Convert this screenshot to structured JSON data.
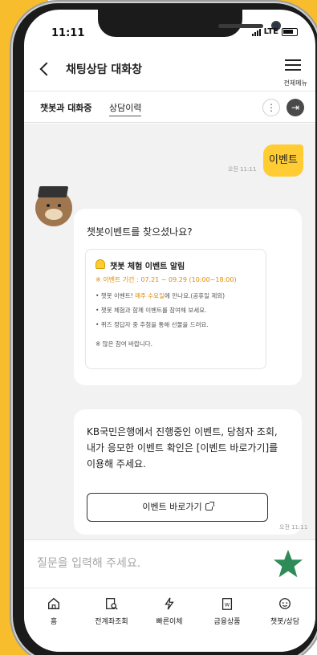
{
  "status_bar": {
    "time": "11:11",
    "network": "LTE"
  },
  "header": {
    "title": "채팅상담 대화창",
    "menu_label": "전체메뉴"
  },
  "tabs": {
    "active": "챗봇과 대화중",
    "history": "상담이력"
  },
  "chat": {
    "user_message": {
      "text": "이벤트",
      "time": "오전 11:11"
    },
    "bot_question": "챗봇이벤트를 찾으셨나요?",
    "notice": {
      "title": "챗봇 체험 이벤트 알림",
      "period": "※ 이벤트 기간 : 07.21 ~ 09.29 (10:00~18:00)",
      "line1_prefix": "• 챗봇 이벤트! ",
      "line1_highlight": "매주 수요일",
      "line1_suffix": "에 만나요.(공휴일 제외)",
      "line2": "• 챗봇 체험과 함께 이벤트를 참여해 보세요.",
      "line3": "• 퀴즈 정답자 중 추첨을 통해 선물을 드려요.",
      "line4": "※ 많은 참여 바랍니다."
    },
    "bot_info": "KB국민은행에서 진행중인 이벤트, 당첨자 조회, 내가 응모한 이벤트 확인은 [이벤트 바로가기]를 이용해 주세요.",
    "link_button": "이벤트 바로가기",
    "bot_time": "오전 11:11"
  },
  "composer": {
    "placeholder": "질문을 입력해 주세요."
  },
  "tabbar": [
    {
      "label": "홈",
      "icon": "home-icon"
    },
    {
      "label": "전계좌조회",
      "icon": "account-search-icon"
    },
    {
      "label": "빠른이체",
      "icon": "quick-transfer-icon"
    },
    {
      "label": "금융상품",
      "icon": "financial-product-icon"
    },
    {
      "label": "챗봇/상담",
      "icon": "chatbot-icon"
    }
  ],
  "colors": {
    "accent": "#ffcc33",
    "send": "#2e8b57",
    "highlight": "#e08b00",
    "background_yellow": "#f7bd2c"
  }
}
